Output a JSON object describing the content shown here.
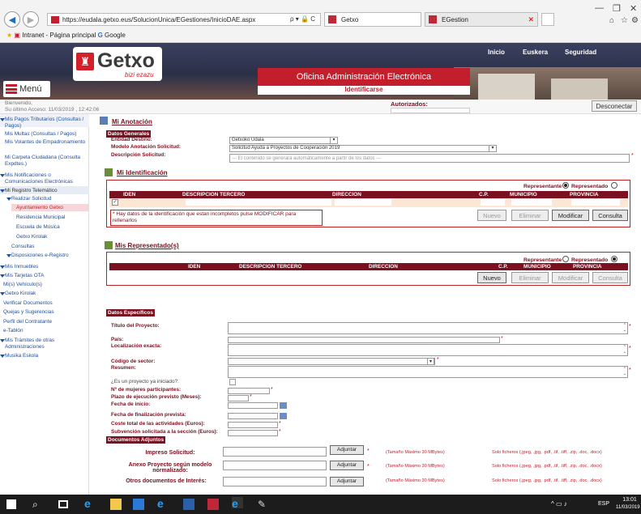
{
  "browser": {
    "url": "https://eudala.getxo.eus/SolucionUnica/EGestiones/InicioDAE.aspx",
    "search_hint": "ρ ▾ 🔒 C",
    "tabs": [
      {
        "label": "Getxo"
      },
      {
        "label": "EGestion"
      }
    ],
    "favorites": {
      "intranet": "Intranet - Página principal",
      "google": "Google"
    }
  },
  "header": {
    "logo_text": "Getxo",
    "logo_sub": "bizi ezazu",
    "menu_label": "Menú",
    "nav": [
      "Inicio",
      "Euskera",
      "Seguridad"
    ],
    "office_title": "Oficina Administración Electrónica",
    "identify_link": "Identificarse"
  },
  "subheader": {
    "welcome": "Bienvenido,",
    "last_access": "Su último Acceso: 11/03/2019 , 12:42:06",
    "authorized_label": "Autorizados:",
    "disconnect": "Desconectar"
  },
  "sidebar": [
    {
      "label": "Mis Pagos Tributarios (Consultas / Pagos)",
      "arrow": true
    },
    {
      "label": "Mis Multas (Consultas / Pagos)",
      "arrow": false
    },
    {
      "label": "Mis Volantes de Empadronamiento",
      "arrow": false
    },
    {
      "label": "Mi Carpeta Ciudadana (Consulta Expdtes.)",
      "arrow": false
    },
    {
      "label": "Mis Notificaciones o Comunicaciones Electrónicas",
      "arrow": true
    },
    {
      "label": "Mi Registro Telemático",
      "arrow": true
    },
    {
      "label": "Realizar Solicitud",
      "arrow": true
    },
    {
      "label": "Ayuntamiento Getxo",
      "arrow": false
    },
    {
      "label": "Residencia Municipal",
      "arrow": false
    },
    {
      "label": "Escuela de Música",
      "arrow": false
    },
    {
      "label": "Getxo Kirolak",
      "arrow": false
    },
    {
      "label": "Consultas",
      "arrow": false
    },
    {
      "label": "Disposiciones e-Registro",
      "arrow": true
    },
    {
      "label": "Mis Inmuebles",
      "arrow": true
    },
    {
      "label": "Mis Tarjetas OTA",
      "arrow": true
    },
    {
      "label": "Mi(s) Vehículo(s)",
      "arrow": false
    },
    {
      "label": "Getxo Kirolak",
      "arrow": true
    },
    {
      "label": "Verificar Documentos",
      "arrow": false
    },
    {
      "label": "Quejas y Sugerencias",
      "arrow": false
    },
    {
      "label": "Perfil del Contratante",
      "arrow": false
    },
    {
      "label": "e-Tablón",
      "arrow": false
    },
    {
      "label": "Mis Trámites de otras Administraciones",
      "arrow": true
    },
    {
      "label": "Musika Eskola",
      "arrow": true
    }
  ],
  "anotacion": {
    "title": "Mi Anotación",
    "tag": "Datos Generales",
    "entidad_label": "Entidad Destino:",
    "entidad_value": "Getxoko Udala",
    "modelo_label": "Modelo Anotación Solicitud:",
    "modelo_value": "Solicitud Ayuda a Proyectos de Cooperación 2019",
    "descripcion_label": "Descripción Solicitud:",
    "descripcion_value": "--- El contenido se generará automáticamente a partir de los datos ---"
  },
  "identificacion": {
    "title": "Mi Identificación",
    "rep_label": "Representante",
    "repd_label": "Representado",
    "columns": [
      "IDEN",
      "DESCRIPCION TERCERO",
      "DIRECCION",
      "C.P.",
      "MUNICIPIO",
      "PROVINCIA"
    ],
    "warning": "* Hay datos de la identificación que estan incompletos pulse MODIFICAR para rellenarlos",
    "buttons": [
      "Nuevo",
      "Eliminar",
      "Modificar",
      "Consulta"
    ]
  },
  "representados": {
    "title": "Mis Representado(s)",
    "rep_label": "Representante",
    "repd_label": "Representado",
    "columns": [
      "IDEN",
      "DESCRIPCION TERCERO",
      "DIRECCION",
      "C.P.",
      "MUNICIPIO",
      "PROVINCIA"
    ],
    "buttons": [
      "Nuevo",
      "Eliminar",
      "Modificar",
      "Consulta"
    ]
  },
  "especificos": {
    "tag": "Datos Específicos",
    "fields": {
      "titulo": "Título del Proyecto:",
      "pais": "País:",
      "localizacion": "Localización exacta:",
      "codigo": "Código de sector:",
      "resumen": "Resumen:",
      "iniciado": "¿Es un proyecto ya iniciado?:",
      "mujeres": "Nº de mujeres participantes:",
      "plazo": "Plazo de ejecución previsto (Meses):",
      "fecha_inicio": "Fecha de inicio:",
      "fecha_fin": "Fecha de finalización prevista:",
      "coste": "Coste total de las actividades (Euros):",
      "subvencion": "Subvención solicitada a la sección (Euros):"
    }
  },
  "adjuntos": {
    "tag": "Documentos Adjuntos",
    "items": [
      {
        "label": "Impreso Solicitud:",
        "button": "Adjuntar",
        "size": "(Tamaño Máximo 30 MBytes)",
        "types": "Solo ficheros (.jpeg, .jpg, .pdf, .tif, .tiff, .zip, .doc, .docx)"
      },
      {
        "label": "Anexo Proyecto según modelo normalizado:",
        "button": "Adjuntar",
        "size": "(Tamaño Máximo 30 MBytes)",
        "types": "Solo ficheros (.jpeg, .jpg, .pdf, .tif, .tiff, .zip, .doc, .docx)"
      },
      {
        "label": "Otros documentos de Interés:",
        "button": "Adjuntar",
        "size": "(Tamaño Máximo 30 MBytes)",
        "types": "Solo ficheros (.jpeg, .jpg, .pdf, .tif, .tiff, .zip, .doc, .docx)"
      }
    ]
  },
  "taskbar": {
    "time": "13:01",
    "date": "11/03/2019",
    "lang": "ESP"
  }
}
